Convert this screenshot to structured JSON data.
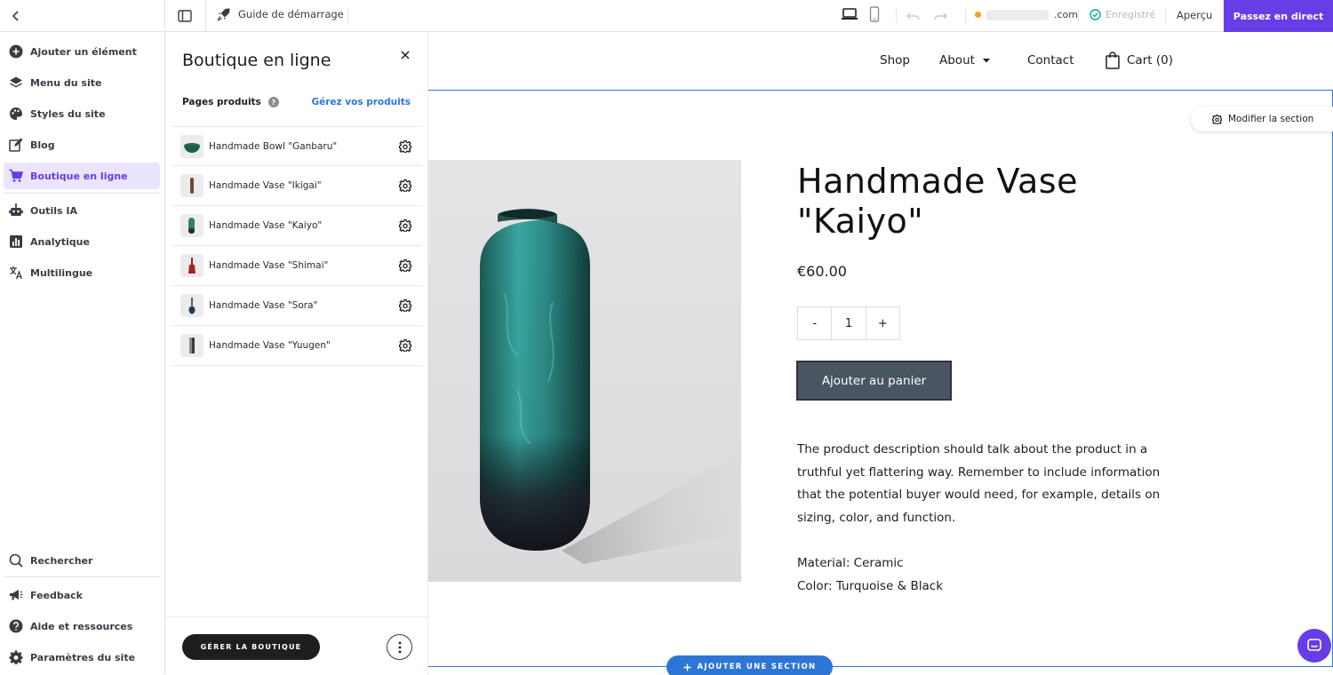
{
  "topbar": {
    "guide_label": "Guide de démarrage",
    "domain_suffix": ".com",
    "saved_label": "Enregistré",
    "preview_label": "Aperçu",
    "publish_label": "Passez en direct"
  },
  "sidebar": {
    "items": [
      {
        "label": "Ajouter un élément",
        "icon": "plus-circle-icon"
      },
      {
        "label": "Menu du site",
        "icon": "layers-icon"
      },
      {
        "label": "Styles du site",
        "icon": "palette-icon"
      },
      {
        "label": "Blog",
        "icon": "edit-icon"
      },
      {
        "label": "Boutique en ligne",
        "icon": "cart-icon",
        "active": true
      },
      {
        "label": "Outils IA",
        "icon": "robot-icon"
      },
      {
        "label": "Analytique",
        "icon": "chart-icon"
      },
      {
        "label": "Multilingue",
        "icon": "translate-icon"
      }
    ],
    "bottom_items": [
      {
        "label": "Rechercher",
        "icon": "search-icon"
      },
      {
        "label": "Feedback",
        "icon": "megaphone-icon"
      },
      {
        "label": "Aide et ressources",
        "icon": "help-icon"
      },
      {
        "label": "Paramètres du site",
        "icon": "gear-icon"
      }
    ]
  },
  "panel": {
    "title": "Boutique en ligne",
    "product_pages_label": "Pages produits",
    "manage_products_link": "Gérez vos produits",
    "products": [
      {
        "name": "Handmade Bowl \"Ganbaru\""
      },
      {
        "name": "Handmade Vase \"Ikigai\""
      },
      {
        "name": "Handmade Vase \"Kaiyo\""
      },
      {
        "name": "Handmade Vase \"Shimai\""
      },
      {
        "name": "Handmade Vase \"Sora\""
      },
      {
        "name": "Handmade Vase \"Yuugen\""
      }
    ],
    "manage_store_label": "GÉRER LA BOUTIQUE"
  },
  "site": {
    "nav": {
      "shop": "Shop",
      "about": "About",
      "contact": "Contact",
      "cart": "Cart (0)"
    },
    "edit_section_label": "Modifier la section",
    "product": {
      "title": "Handmade Vase \"Kaiyo\"",
      "price": "€60.00",
      "qty_minus": "-",
      "qty_value": "1",
      "qty_plus": "+",
      "add_to_cart": "Ajouter au panier",
      "description": "The product description should talk about the product in a truthful yet flattering way. Remember to include information that the potential buyer would need, for example, details on sizing, color, and function.",
      "material": "Material: Ceramic",
      "color": "Color: Turquoise & Black"
    },
    "add_section_label": "AJOUTER UNE SECTION"
  },
  "colors": {
    "brand_purple": "#673de6",
    "editor_blue": "#2e76d6",
    "active_bg": "#ebe4ff",
    "button_dark": "#4a5562"
  }
}
